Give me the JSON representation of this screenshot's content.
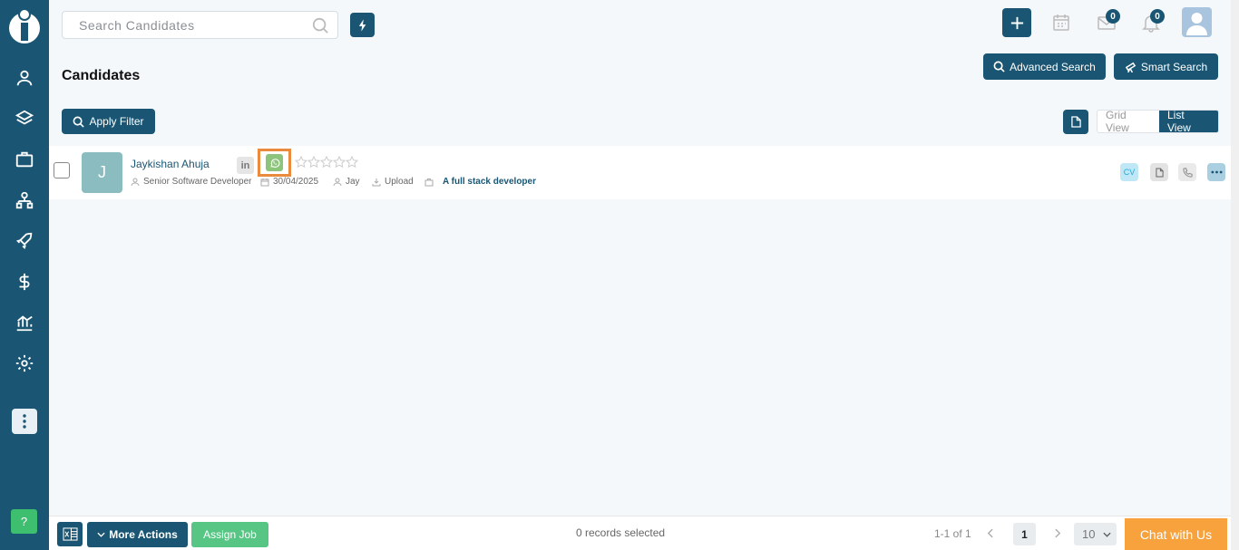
{
  "header": {
    "search_placeholder": "Search Candidates",
    "mail_count": "0",
    "notification_count": "0"
  },
  "page": {
    "title": "Candidates",
    "advanced_search_label": "Advanced Search",
    "smart_search_label": "Smart Search",
    "apply_filter_label": "Apply Filter",
    "grid_view_label": "Grid View",
    "list_view_label": "List View"
  },
  "candidates": [
    {
      "initial": "J",
      "name": "Jaykishan Ahuja",
      "linkedin_label": "in",
      "rating": 0,
      "title": "Senior Software Developer",
      "date": "30/04/2025",
      "owner": "Jay",
      "source": "Upload",
      "summary": "A full stack developer",
      "cv_label": "CV"
    }
  ],
  "footer": {
    "more_actions_label": "More Actions",
    "assign_job_label": "Assign Job",
    "records_selected": "0 records selected",
    "range": "1-1 of 1",
    "current_page": "1",
    "page_size": "10",
    "chat_label": "Chat with Us"
  },
  "sidebar": {
    "help_label": "?"
  },
  "colors": {
    "primary": "#1a5673",
    "success": "#57c684",
    "chat": "#f7a23d",
    "highlight": "#e98a3c",
    "whatsapp": "#8cc47c"
  }
}
